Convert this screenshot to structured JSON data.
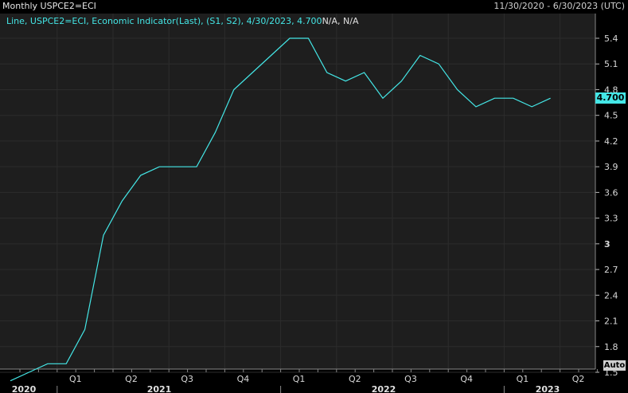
{
  "header": {
    "title": "Monthly USPCE2=ECI",
    "range": "11/30/2020 - 6/30/2023 (UTC)"
  },
  "legend": {
    "text": "Line, USPCE2=ECI, Economic Indicator(Last), (S1, S2), 4/30/2023, 4.700",
    "tail": "N/A, N/A"
  },
  "auto_label": "Auto",
  "last_value_label": "4.700",
  "colors": {
    "series": "#44e6e6",
    "background": "#000000",
    "plot": "#1e1e1e",
    "grid": "#2c2c2c"
  },
  "chart_data": {
    "type": "line",
    "title": "Monthly USPCE2=ECI",
    "y_ticks": [
      "1.5",
      "1.8",
      "2.1",
      "2.4",
      "2.7",
      "3",
      "3.3",
      "3.6",
      "3.9",
      "4.2",
      "4.5",
      "4.8",
      "5.1",
      "5.4"
    ],
    "ylim": [
      1.3,
      5.6
    ],
    "quarter_labels": [
      "Q1",
      "Q2",
      "Q3",
      "Q4",
      "Q1",
      "Q2",
      "Q3",
      "Q4",
      "Q1",
      "Q2"
    ],
    "year_labels": [
      "2020",
      "2021",
      "2022",
      "2023"
    ],
    "series": [
      {
        "x": [
          "2020-11",
          "2020-12",
          "2021-01",
          "2021-02",
          "2021-03",
          "2021-04",
          "2021-05",
          "2021-06",
          "2021-07",
          "2021-08",
          "2021-09",
          "2021-10",
          "2021-11",
          "2021-12",
          "2022-01",
          "2022-02",
          "2022-03",
          "2022-04",
          "2022-05",
          "2022-06",
          "2022-07",
          "2022-08",
          "2022-09",
          "2022-10",
          "2022-11",
          "2022-12",
          "2023-01",
          "2023-02",
          "2023-03",
          "2023-04"
        ],
        "values": [
          1.4,
          1.5,
          1.6,
          1.6,
          2.0,
          3.1,
          3.5,
          3.8,
          3.9,
          3.9,
          3.9,
          4.3,
          4.8,
          5.0,
          5.2,
          5.4,
          5.4,
          5.0,
          4.9,
          5.0,
          4.7,
          4.9,
          5.2,
          5.1,
          4.8,
          4.6,
          4.7,
          4.7,
          4.6,
          4.7
        ]
      }
    ]
  }
}
